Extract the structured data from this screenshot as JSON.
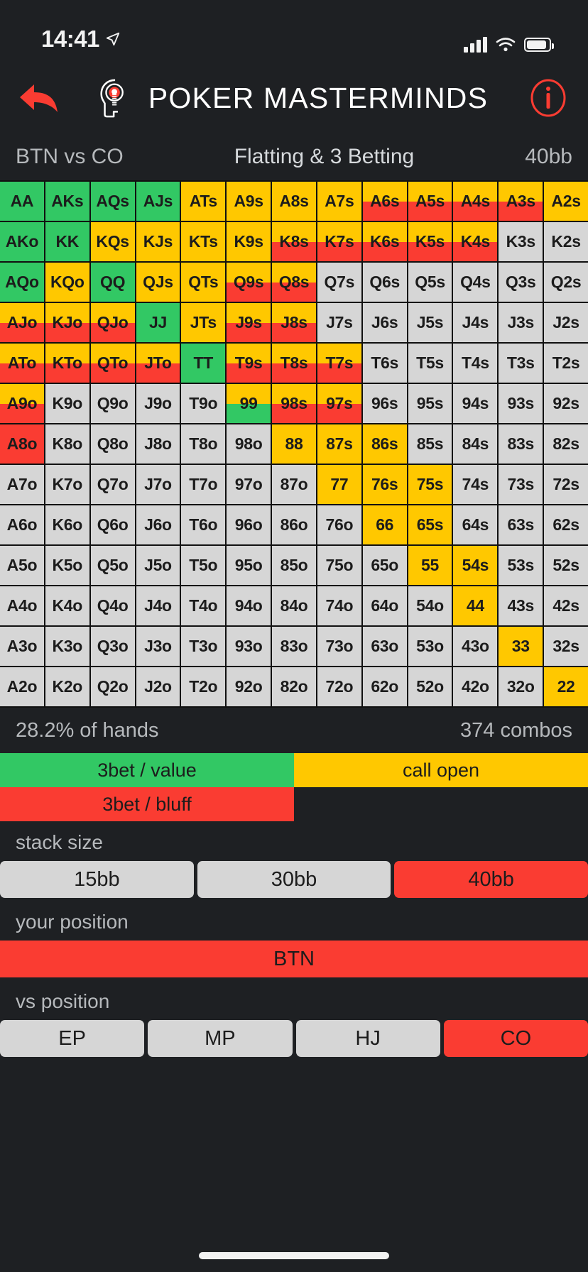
{
  "status_bar": {
    "time": "14:41",
    "location_icon": "location-arrow-icon",
    "signal_icon": "cellular-signal-icon",
    "wifi_icon": "wifi-icon",
    "battery_icon": "battery-icon"
  },
  "header": {
    "back_icon": "back-arrow-icon",
    "logo_icon": "poker-masterminds-logo-icon",
    "title": "POKER MASTERMINDS",
    "info_icon": "info-circle-icon",
    "accent_color": "#fa3c32"
  },
  "context": {
    "matchup": "BTN vs CO",
    "scenario": "Flatting & 3 Betting",
    "stack": "40bb"
  },
  "colors": {
    "value_3bet": "#32c864",
    "call_open": "#ffc800",
    "bluff_3bet": "#fa3c32",
    "fold": "#d6d6d6",
    "background": "#1e2023",
    "grid_line": "#111111"
  },
  "stats": {
    "percent_of_hands": "28.2% of hands",
    "combos": "374 combos"
  },
  "legend": [
    {
      "label": "3bet / value",
      "color": "#32c864"
    },
    {
      "label": "call open",
      "color": "#ffc800"
    },
    {
      "label": "3bet / bluff",
      "color": "#fa3c32"
    }
  ],
  "controls": {
    "stack_size": {
      "label": "stack size",
      "options": [
        "15bb",
        "30bb",
        "40bb"
      ],
      "selected": "40bb"
    },
    "your_position": {
      "label": "your position",
      "options": [
        "BTN"
      ],
      "selected": "BTN"
    },
    "vs_position": {
      "label": "vs position",
      "options": [
        "EP",
        "MP",
        "HJ",
        "CO"
      ],
      "selected": "CO"
    }
  },
  "chart_data": {
    "type": "heatmap",
    "title": "Flatting & 3 Betting — BTN vs CO, 40bb",
    "description": "13x13 poker starting hand matrix. Rows/columns ordered A,K,Q,J,T,9,8,7,6,5,4,3,2. Upper-right triangle = suited (s), diagonal = pairs, lower-left = offsuit (o). Cells may be split horizontally into two actions (top portion / bottom portion).",
    "ranks": [
      "A",
      "K",
      "Q",
      "J",
      "T",
      "9",
      "8",
      "7",
      "6",
      "5",
      "4",
      "3",
      "2"
    ],
    "actions": {
      "green": "3bet / value",
      "yellow": "call open",
      "red": "3bet / bluff",
      "grey": "fold"
    },
    "rows": [
      [
        {
          "h": "AA",
          "t": "green"
        },
        {
          "h": "AKs",
          "t": "green"
        },
        {
          "h": "AQs",
          "t": "green"
        },
        {
          "h": "AJs",
          "t": "green"
        },
        {
          "h": "ATs",
          "t": "yellow"
        },
        {
          "h": "A9s",
          "t": "yellow"
        },
        {
          "h": "A8s",
          "t": "yellow"
        },
        {
          "h": "A7s",
          "t": "yellow"
        },
        {
          "h": "A6s",
          "t": "yellow",
          "b": "red",
          "split": 0.5
        },
        {
          "h": "A5s",
          "t": "yellow",
          "b": "red",
          "split": 0.5
        },
        {
          "h": "A4s",
          "t": "yellow",
          "b": "red",
          "split": 0.5
        },
        {
          "h": "A3s",
          "t": "yellow",
          "b": "red",
          "split": 0.5
        },
        {
          "h": "A2s",
          "t": "yellow"
        }
      ],
      [
        {
          "h": "AKo",
          "t": "green"
        },
        {
          "h": "KK",
          "t": "green"
        },
        {
          "h": "KQs",
          "t": "yellow"
        },
        {
          "h": "KJs",
          "t": "yellow"
        },
        {
          "h": "KTs",
          "t": "yellow"
        },
        {
          "h": "K9s",
          "t": "yellow"
        },
        {
          "h": "K8s",
          "t": "yellow",
          "b": "red",
          "split": 0.5
        },
        {
          "h": "K7s",
          "t": "yellow",
          "b": "red",
          "split": 0.5
        },
        {
          "h": "K6s",
          "t": "yellow",
          "b": "red",
          "split": 0.5
        },
        {
          "h": "K5s",
          "t": "yellow",
          "b": "red",
          "split": 0.5
        },
        {
          "h": "K4s",
          "t": "yellow",
          "b": "red",
          "split": 0.5
        },
        {
          "h": "K3s",
          "t": "grey"
        },
        {
          "h": "K2s",
          "t": "grey"
        }
      ],
      [
        {
          "h": "AQo",
          "t": "green"
        },
        {
          "h": "KQo",
          "t": "yellow"
        },
        {
          "h": "QQ",
          "t": "green"
        },
        {
          "h": "QJs",
          "t": "yellow"
        },
        {
          "h": "QTs",
          "t": "yellow"
        },
        {
          "h": "Q9s",
          "t": "yellow",
          "b": "red",
          "split": 0.5
        },
        {
          "h": "Q8s",
          "t": "yellow",
          "b": "red",
          "split": 0.5
        },
        {
          "h": "Q7s",
          "t": "grey"
        },
        {
          "h": "Q6s",
          "t": "grey"
        },
        {
          "h": "Q5s",
          "t": "grey"
        },
        {
          "h": "Q4s",
          "t": "grey"
        },
        {
          "h": "Q3s",
          "t": "grey"
        },
        {
          "h": "Q2s",
          "t": "grey"
        }
      ],
      [
        {
          "h": "AJo",
          "t": "yellow",
          "b": "red",
          "split": 0.5
        },
        {
          "h": "KJo",
          "t": "yellow",
          "b": "red",
          "split": 0.5
        },
        {
          "h": "QJo",
          "t": "yellow",
          "b": "red",
          "split": 0.5
        },
        {
          "h": "JJ",
          "t": "green"
        },
        {
          "h": "JTs",
          "t": "yellow"
        },
        {
          "h": "J9s",
          "t": "yellow",
          "b": "red",
          "split": 0.5
        },
        {
          "h": "J8s",
          "t": "yellow",
          "b": "red",
          "split": 0.5
        },
        {
          "h": "J7s",
          "t": "grey"
        },
        {
          "h": "J6s",
          "t": "grey"
        },
        {
          "h": "J5s",
          "t": "grey"
        },
        {
          "h": "J4s",
          "t": "grey"
        },
        {
          "h": "J3s",
          "t": "grey"
        },
        {
          "h": "J2s",
          "t": "grey"
        }
      ],
      [
        {
          "h": "ATo",
          "t": "yellow",
          "b": "red",
          "split": 0.5
        },
        {
          "h": "KTo",
          "t": "yellow",
          "b": "red",
          "split": 0.5
        },
        {
          "h": "QTo",
          "t": "yellow",
          "b": "red",
          "split": 0.5
        },
        {
          "h": "JTo",
          "t": "yellow",
          "b": "red",
          "split": 0.5
        },
        {
          "h": "TT",
          "t": "green"
        },
        {
          "h": "T9s",
          "t": "yellow",
          "b": "red",
          "split": 0.5
        },
        {
          "h": "T8s",
          "t": "yellow",
          "b": "red",
          "split": 0.5
        },
        {
          "h": "T7s",
          "t": "yellow",
          "b": "red",
          "split": 0.5
        },
        {
          "h": "T6s",
          "t": "grey"
        },
        {
          "h": "T5s",
          "t": "grey"
        },
        {
          "h": "T4s",
          "t": "grey"
        },
        {
          "h": "T3s",
          "t": "grey"
        },
        {
          "h": "T2s",
          "t": "grey"
        }
      ],
      [
        {
          "h": "A9o",
          "t": "yellow",
          "b": "red",
          "split": 0.5
        },
        {
          "h": "K9o",
          "t": "grey"
        },
        {
          "h": "Q9o",
          "t": "grey"
        },
        {
          "h": "J9o",
          "t": "grey"
        },
        {
          "h": "T9o",
          "t": "grey"
        },
        {
          "h": "99",
          "t": "yellow",
          "b": "green",
          "split": 0.5
        },
        {
          "h": "98s",
          "t": "yellow",
          "b": "red",
          "split": 0.5
        },
        {
          "h": "97s",
          "t": "yellow",
          "b": "red",
          "split": 0.5
        },
        {
          "h": "96s",
          "t": "grey"
        },
        {
          "h": "95s",
          "t": "grey"
        },
        {
          "h": "94s",
          "t": "grey"
        },
        {
          "h": "93s",
          "t": "grey"
        },
        {
          "h": "92s",
          "t": "grey"
        }
      ],
      [
        {
          "h": "A8o",
          "t": "red"
        },
        {
          "h": "K8o",
          "t": "grey"
        },
        {
          "h": "Q8o",
          "t": "grey"
        },
        {
          "h": "J8o",
          "t": "grey"
        },
        {
          "h": "T8o",
          "t": "grey"
        },
        {
          "h": "98o",
          "t": "grey"
        },
        {
          "h": "88",
          "t": "yellow"
        },
        {
          "h": "87s",
          "t": "yellow"
        },
        {
          "h": "86s",
          "t": "yellow"
        },
        {
          "h": "85s",
          "t": "grey"
        },
        {
          "h": "84s",
          "t": "grey"
        },
        {
          "h": "83s",
          "t": "grey"
        },
        {
          "h": "82s",
          "t": "grey"
        }
      ],
      [
        {
          "h": "A7o",
          "t": "grey"
        },
        {
          "h": "K7o",
          "t": "grey"
        },
        {
          "h": "Q7o",
          "t": "grey"
        },
        {
          "h": "J7o",
          "t": "grey"
        },
        {
          "h": "T7o",
          "t": "grey"
        },
        {
          "h": "97o",
          "t": "grey"
        },
        {
          "h": "87o",
          "t": "grey"
        },
        {
          "h": "77",
          "t": "yellow"
        },
        {
          "h": "76s",
          "t": "yellow"
        },
        {
          "h": "75s",
          "t": "yellow"
        },
        {
          "h": "74s",
          "t": "grey"
        },
        {
          "h": "73s",
          "t": "grey"
        },
        {
          "h": "72s",
          "t": "grey"
        }
      ],
      [
        {
          "h": "A6o",
          "t": "grey"
        },
        {
          "h": "K6o",
          "t": "grey"
        },
        {
          "h": "Q6o",
          "t": "grey"
        },
        {
          "h": "J6o",
          "t": "grey"
        },
        {
          "h": "T6o",
          "t": "grey"
        },
        {
          "h": "96o",
          "t": "grey"
        },
        {
          "h": "86o",
          "t": "grey"
        },
        {
          "h": "76o",
          "t": "grey"
        },
        {
          "h": "66",
          "t": "yellow"
        },
        {
          "h": "65s",
          "t": "yellow"
        },
        {
          "h": "64s",
          "t": "grey"
        },
        {
          "h": "63s",
          "t": "grey"
        },
        {
          "h": "62s",
          "t": "grey"
        }
      ],
      [
        {
          "h": "A5o",
          "t": "grey"
        },
        {
          "h": "K5o",
          "t": "grey"
        },
        {
          "h": "Q5o",
          "t": "grey"
        },
        {
          "h": "J5o",
          "t": "grey"
        },
        {
          "h": "T5o",
          "t": "grey"
        },
        {
          "h": "95o",
          "t": "grey"
        },
        {
          "h": "85o",
          "t": "grey"
        },
        {
          "h": "75o",
          "t": "grey"
        },
        {
          "h": "65o",
          "t": "grey"
        },
        {
          "h": "55",
          "t": "yellow"
        },
        {
          "h": "54s",
          "t": "yellow"
        },
        {
          "h": "53s",
          "t": "grey"
        },
        {
          "h": "52s",
          "t": "grey"
        }
      ],
      [
        {
          "h": "A4o",
          "t": "grey"
        },
        {
          "h": "K4o",
          "t": "grey"
        },
        {
          "h": "Q4o",
          "t": "grey"
        },
        {
          "h": "J4o",
          "t": "grey"
        },
        {
          "h": "T4o",
          "t": "grey"
        },
        {
          "h": "94o",
          "t": "grey"
        },
        {
          "h": "84o",
          "t": "grey"
        },
        {
          "h": "74o",
          "t": "grey"
        },
        {
          "h": "64o",
          "t": "grey"
        },
        {
          "h": "54o",
          "t": "grey"
        },
        {
          "h": "44",
          "t": "yellow"
        },
        {
          "h": "43s",
          "t": "grey"
        },
        {
          "h": "42s",
          "t": "grey"
        }
      ],
      [
        {
          "h": "A3o",
          "t": "grey"
        },
        {
          "h": "K3o",
          "t": "grey"
        },
        {
          "h": "Q3o",
          "t": "grey"
        },
        {
          "h": "J3o",
          "t": "grey"
        },
        {
          "h": "T3o",
          "t": "grey"
        },
        {
          "h": "93o",
          "t": "grey"
        },
        {
          "h": "83o",
          "t": "grey"
        },
        {
          "h": "73o",
          "t": "grey"
        },
        {
          "h": "63o",
          "t": "grey"
        },
        {
          "h": "53o",
          "t": "grey"
        },
        {
          "h": "43o",
          "t": "grey"
        },
        {
          "h": "33",
          "t": "yellow"
        },
        {
          "h": "32s",
          "t": "grey"
        }
      ],
      [
        {
          "h": "A2o",
          "t": "grey"
        },
        {
          "h": "K2o",
          "t": "grey"
        },
        {
          "h": "Q2o",
          "t": "grey"
        },
        {
          "h": "J2o",
          "t": "grey"
        },
        {
          "h": "T2o",
          "t": "grey"
        },
        {
          "h": "92o",
          "t": "grey"
        },
        {
          "h": "82o",
          "t": "grey"
        },
        {
          "h": "72o",
          "t": "grey"
        },
        {
          "h": "62o",
          "t": "grey"
        },
        {
          "h": "52o",
          "t": "grey"
        },
        {
          "h": "42o",
          "t": "grey"
        },
        {
          "h": "32o",
          "t": "grey"
        },
        {
          "h": "22",
          "t": "yellow"
        }
      ]
    ]
  }
}
